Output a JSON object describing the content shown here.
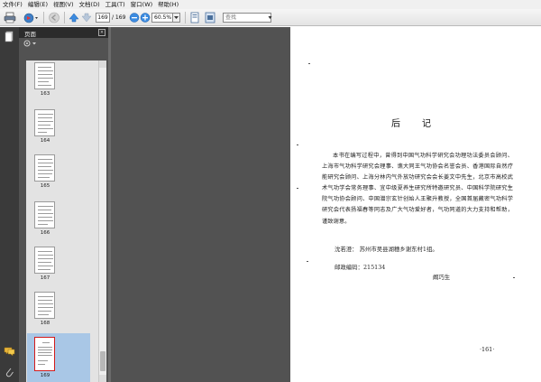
{
  "menubar": {
    "items": [
      "文件(F)",
      "编辑(E)",
      "视图(V)",
      "文档(D)",
      "工具(T)",
      "窗口(W)",
      "帮助(H)"
    ]
  },
  "toolbar": {
    "page_value": "169",
    "page_total": "/ 169",
    "zoom_value": "60.5%",
    "find_placeholder": "查找"
  },
  "panel": {
    "title": "页面",
    "close_glyph": "×",
    "thumbnails": [
      {
        "label": "163"
      },
      {
        "label": "164"
      },
      {
        "label": "165"
      },
      {
        "label": "166"
      },
      {
        "label": "167"
      },
      {
        "label": "168"
      },
      {
        "label": "169"
      }
    ]
  },
  "document": {
    "title": "后记",
    "paragraph": "本书在编写过程中，曾得到中国气功科学研究会功理功法委员会顾问、上海市气功科学研究会理事、谯大同王气功协会名誉会员、香港国际自然疗能研究会顾问、上海分林内气外放功研究会会长姜文中先生，北京市高校武术气功学会常务理事、宜中级夏养生研究所特邀研究员、中国科学院研究生院气功协会顾问、中国潜宗玄针创始人王聚升教授，全国首届藏密气功科学研究会代表扬福春等同志及广大气功爱好者，气功同道的大力支持和帮助，谨致谢意。",
    "address": "沈若澄：  苏州市吴县湖穗乡谢东村1组。",
    "postal": "邮政编码：215134",
    "author": "阚巧生",
    "page_number": "·161·"
  },
  "colors": {
    "workspace": "#525252",
    "selection": "#a9c7e6",
    "selected_border": "#d21b1b"
  }
}
